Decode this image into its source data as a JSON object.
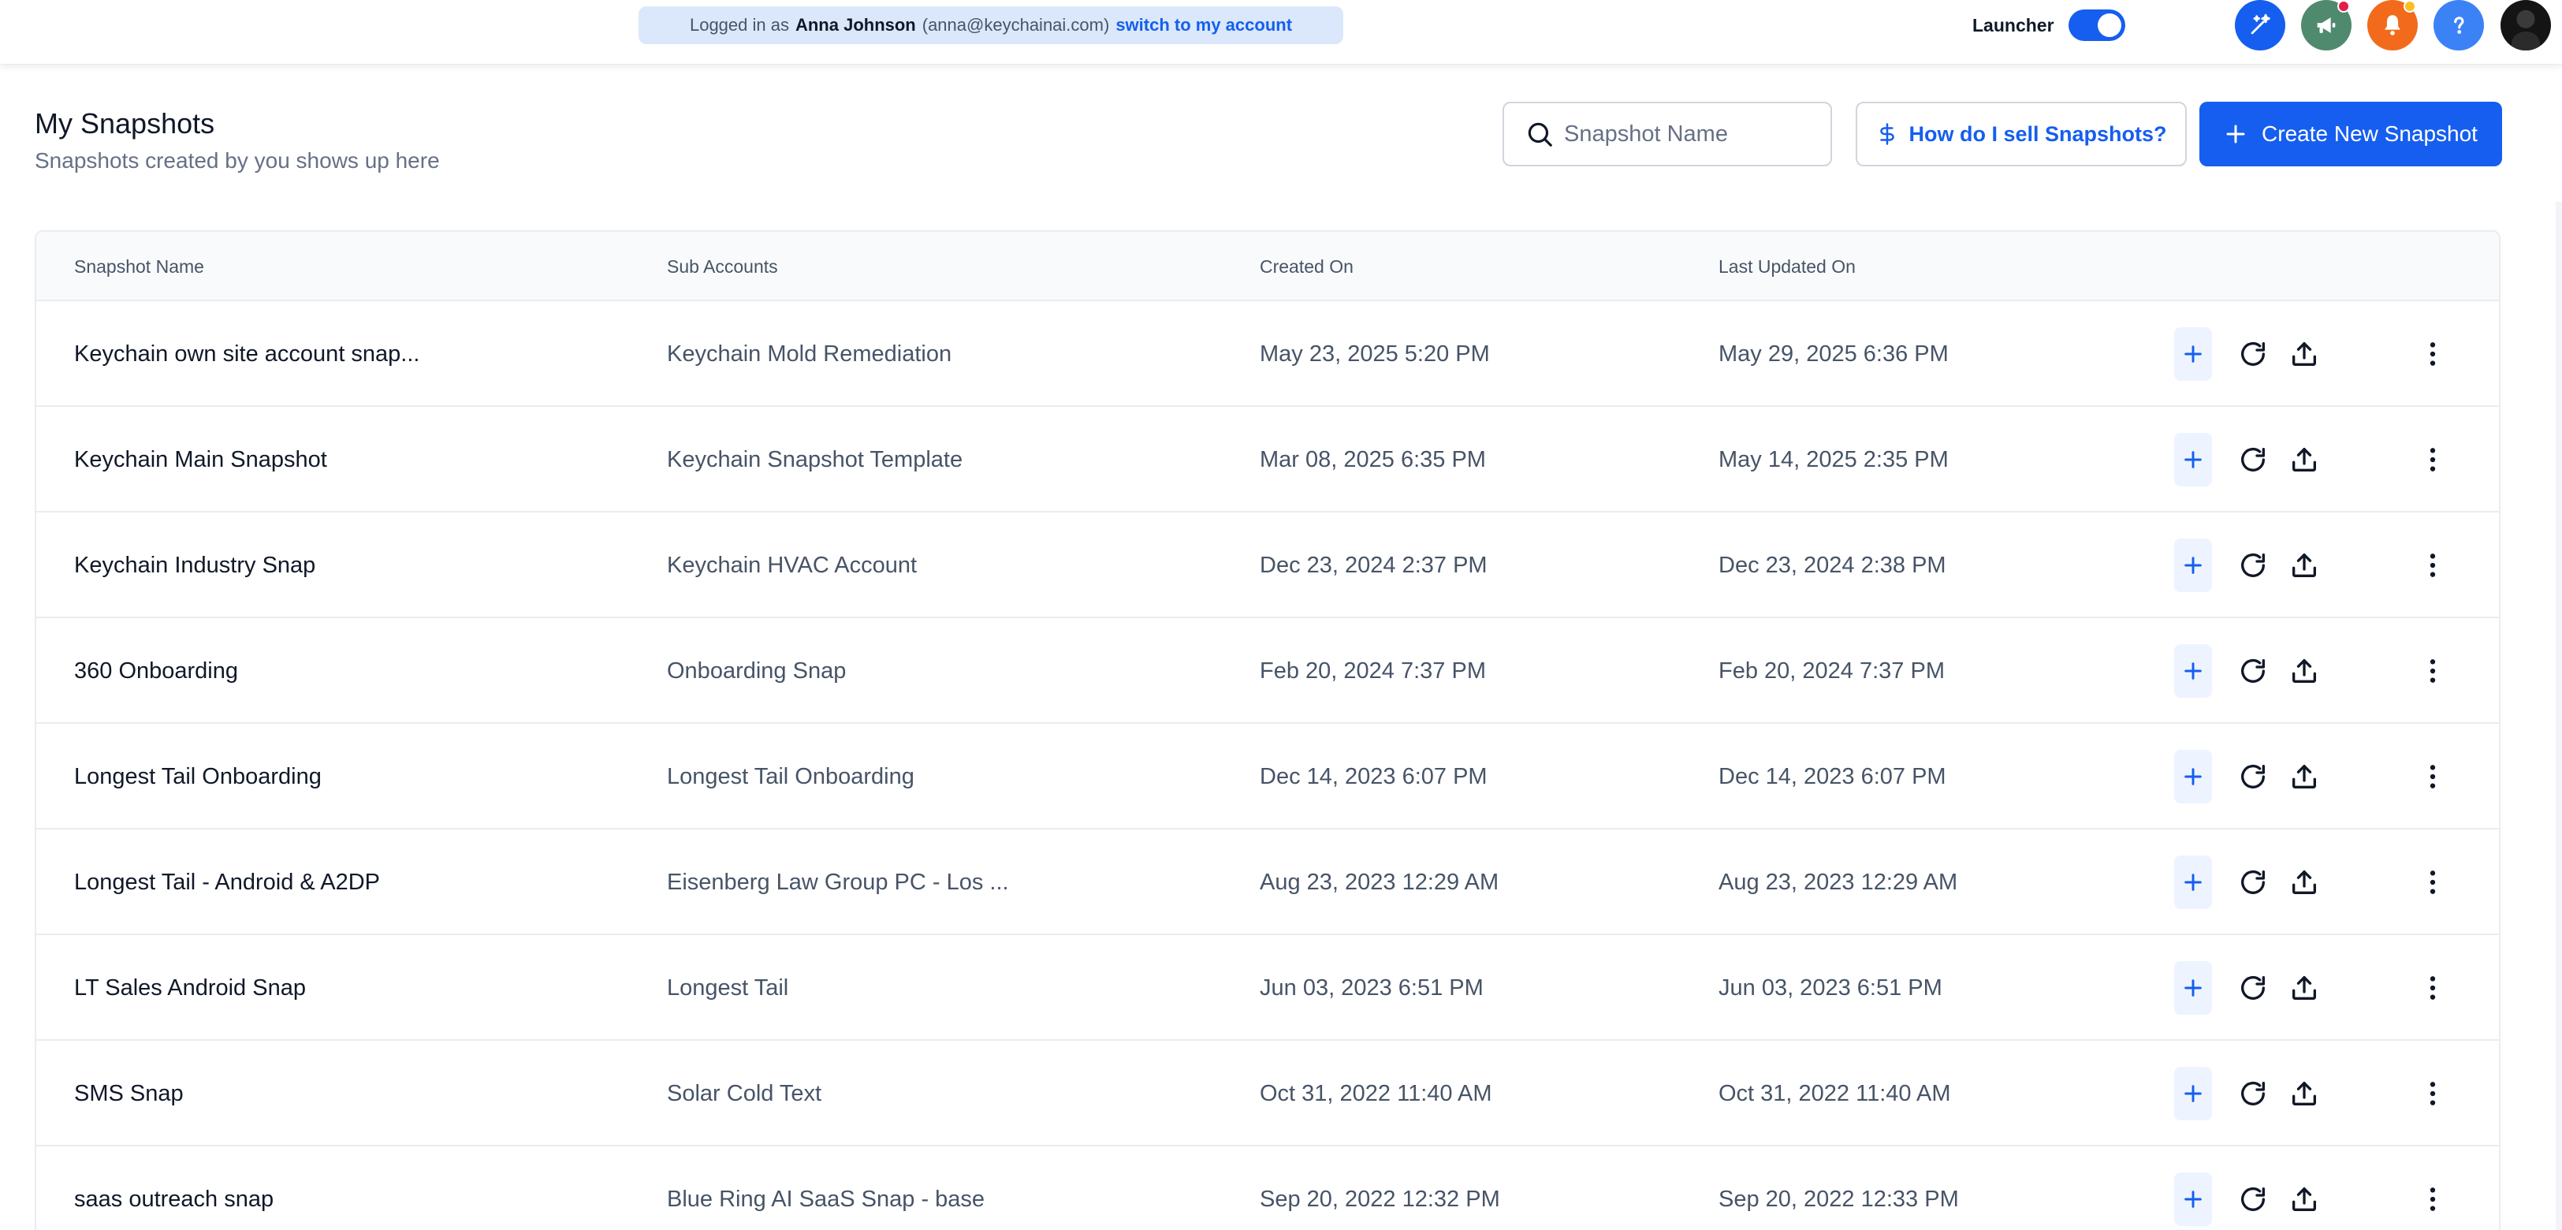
{
  "topbar": {
    "impersonation": {
      "prefix": "Logged in as",
      "name": "Anna Johnson",
      "email": "(anna@keychainai.com)",
      "switch_label": "switch to my account"
    },
    "launcher_label": "Launcher",
    "launcher_on": true,
    "icons": [
      {
        "name": "magic-wand-icon",
        "color": "#155eef"
      },
      {
        "name": "megaphone-icon",
        "color": "#4f8a6e"
      },
      {
        "name": "bell-icon",
        "color": "#f26b1d"
      },
      {
        "name": "help-icon",
        "color": "#3b82f6"
      }
    ]
  },
  "header": {
    "title": "My Snapshots",
    "subtitle": "Snapshots created by you shows up here"
  },
  "search": {
    "placeholder": "Snapshot Name",
    "value": ""
  },
  "buttons": {
    "sell_label": "How do I sell Snapshots?",
    "create_label": "Create New Snapshot"
  },
  "colors": {
    "primary": "#155eef",
    "primary_light": "#eef4ff",
    "border": "#eaecf0",
    "muted_text": "#475467"
  },
  "table": {
    "columns": [
      "Snapshot Name",
      "Sub Accounts",
      "Created On",
      "Last Updated On"
    ],
    "rows": [
      {
        "name": "Keychain own site account snap...",
        "sub_account": "Keychain Mold Remediation",
        "created": "May 23, 2025 5:20 PM",
        "updated": "May 29, 2025 6:36 PM"
      },
      {
        "name": "Keychain Main Snapshot",
        "sub_account": "Keychain Snapshot Template",
        "created": "Mar 08, 2025 6:35 PM",
        "updated": "May 14, 2025 2:35 PM"
      },
      {
        "name": "Keychain Industry Snap",
        "sub_account": "Keychain HVAC Account",
        "created": "Dec 23, 2024 2:37 PM",
        "updated": "Dec 23, 2024 2:38 PM"
      },
      {
        "name": "360 Onboarding",
        "sub_account": "Onboarding Snap",
        "created": "Feb 20, 2024 7:37 PM",
        "updated": "Feb 20, 2024 7:37 PM"
      },
      {
        "name": "Longest Tail Onboarding",
        "sub_account": "Longest Tail Onboarding",
        "created": "Dec 14, 2023 6:07 PM",
        "updated": "Dec 14, 2023 6:07 PM"
      },
      {
        "name": "Longest Tail - Android & A2DP",
        "sub_account": "Eisenberg Law Group PC - Los ...",
        "created": "Aug 23, 2023 12:29 AM",
        "updated": "Aug 23, 2023 12:29 AM"
      },
      {
        "name": "LT Sales Android Snap",
        "sub_account": "Longest Tail",
        "created": "Jun 03, 2023 6:51 PM",
        "updated": "Jun 03, 2023 6:51 PM"
      },
      {
        "name": "SMS Snap",
        "sub_account": "Solar Cold Text",
        "created": "Oct 31, 2022 11:40 AM",
        "updated": "Oct 31, 2022 11:40 AM"
      },
      {
        "name": "saas outreach snap",
        "sub_account": "Blue Ring AI SaaS Snap - base",
        "created": "Sep 20, 2022 12:32 PM",
        "updated": "Sep 20, 2022 12:33 PM"
      }
    ]
  }
}
